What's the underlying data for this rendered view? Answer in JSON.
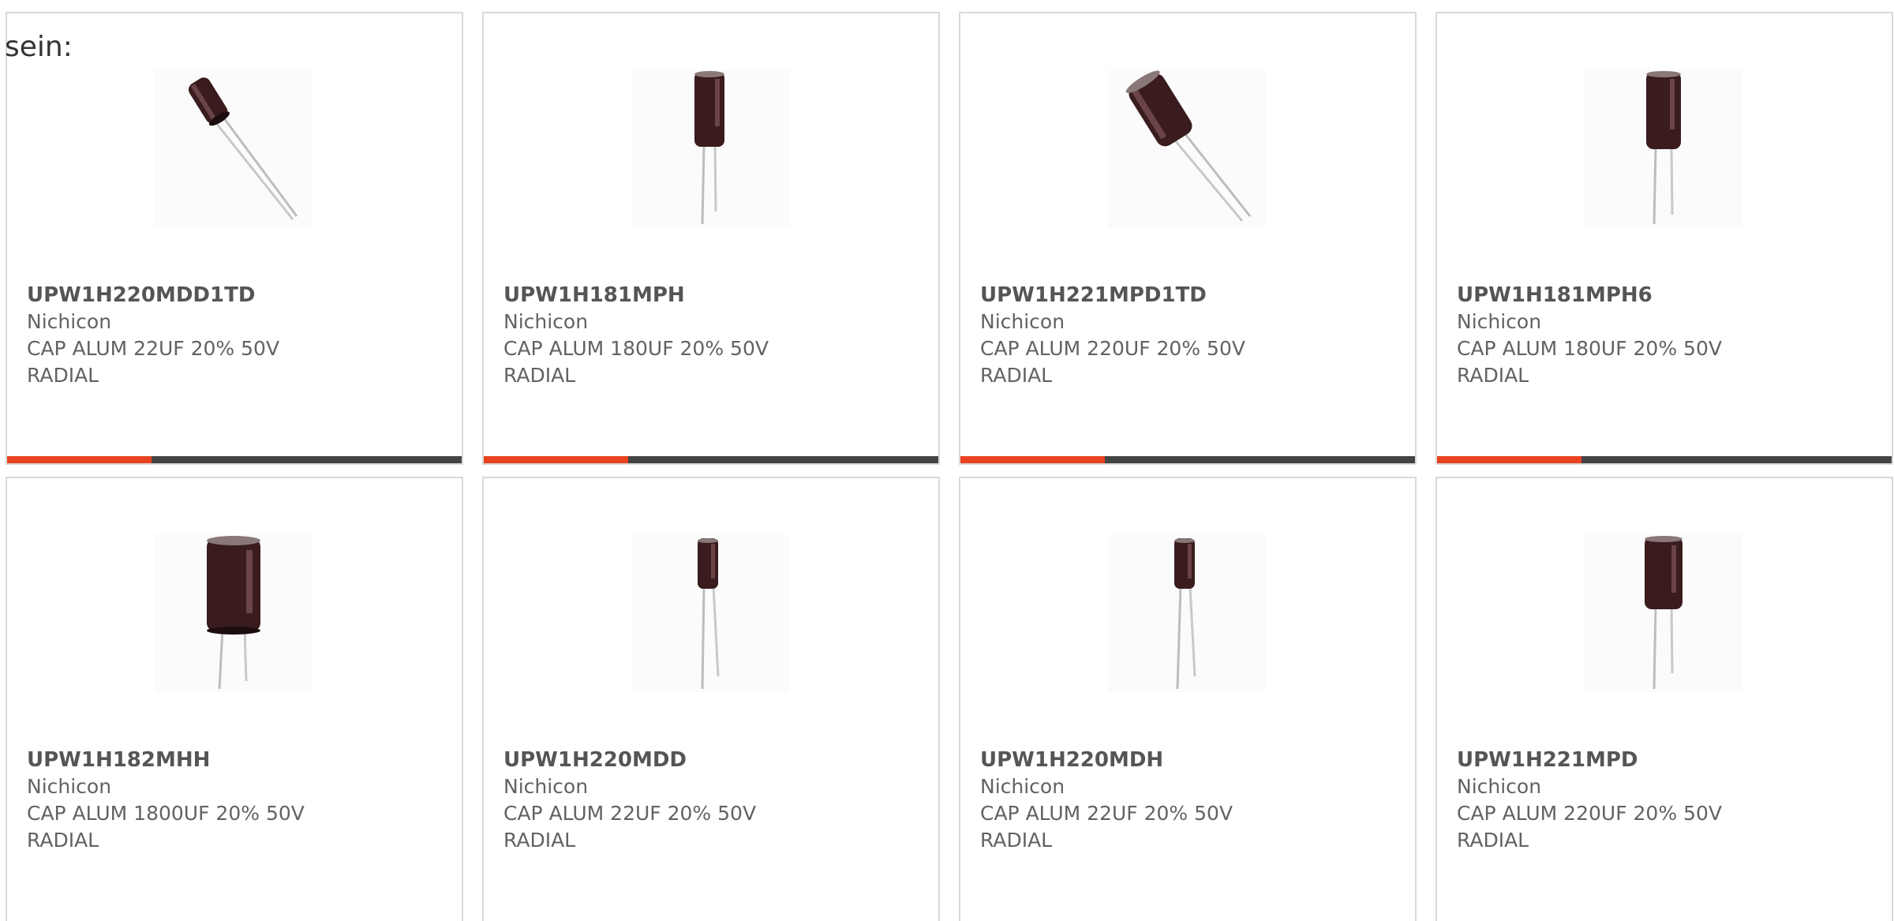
{
  "intro_text": "sein:",
  "colors": {
    "accent": "#e8421f",
    "bar": "#444444",
    "border": "#d9d9d9",
    "text": "#626262"
  },
  "products": [
    {
      "part": "UPW1H220MDD1TD",
      "brand": "Nichicon",
      "desc": "CAP ALUM 22UF 20% 50V",
      "package": "RADIAL",
      "image": "capacitor-tilted-icon"
    },
    {
      "part": "UPW1H181MPH",
      "brand": "Nichicon",
      "desc": "CAP ALUM 180UF 20% 50V",
      "package": "RADIAL",
      "image": "capacitor-upright-icon"
    },
    {
      "part": "UPW1H221MPD1TD",
      "brand": "Nichicon",
      "desc": "CAP ALUM 220UF 20% 50V",
      "package": "RADIAL",
      "image": "capacitor-tilted-icon"
    },
    {
      "part": "UPW1H181MPH6",
      "brand": "Nichicon",
      "desc": "CAP ALUM 180UF 20% 50V",
      "package": "RADIAL",
      "image": "capacitor-upright-icon"
    },
    {
      "part": "UPW1H182MHH",
      "brand": "Nichicon",
      "desc": "CAP ALUM 1800UF 20% 50V",
      "package": "RADIAL",
      "image": "capacitor-large-icon"
    },
    {
      "part": "UPW1H220MDD",
      "brand": "Nichicon",
      "desc": "CAP ALUM 22UF 20% 50V",
      "package": "RADIAL",
      "image": "capacitor-small-icon"
    },
    {
      "part": "UPW1H220MDH",
      "brand": "Nichicon",
      "desc": "CAP ALUM 22UF 20% 50V",
      "package": "RADIAL",
      "image": "capacitor-small-icon"
    },
    {
      "part": "UPW1H221MPD",
      "brand": "Nichicon",
      "desc": "CAP ALUM 220UF 20% 50V",
      "package": "RADIAL",
      "image": "capacitor-upright-icon"
    }
  ]
}
